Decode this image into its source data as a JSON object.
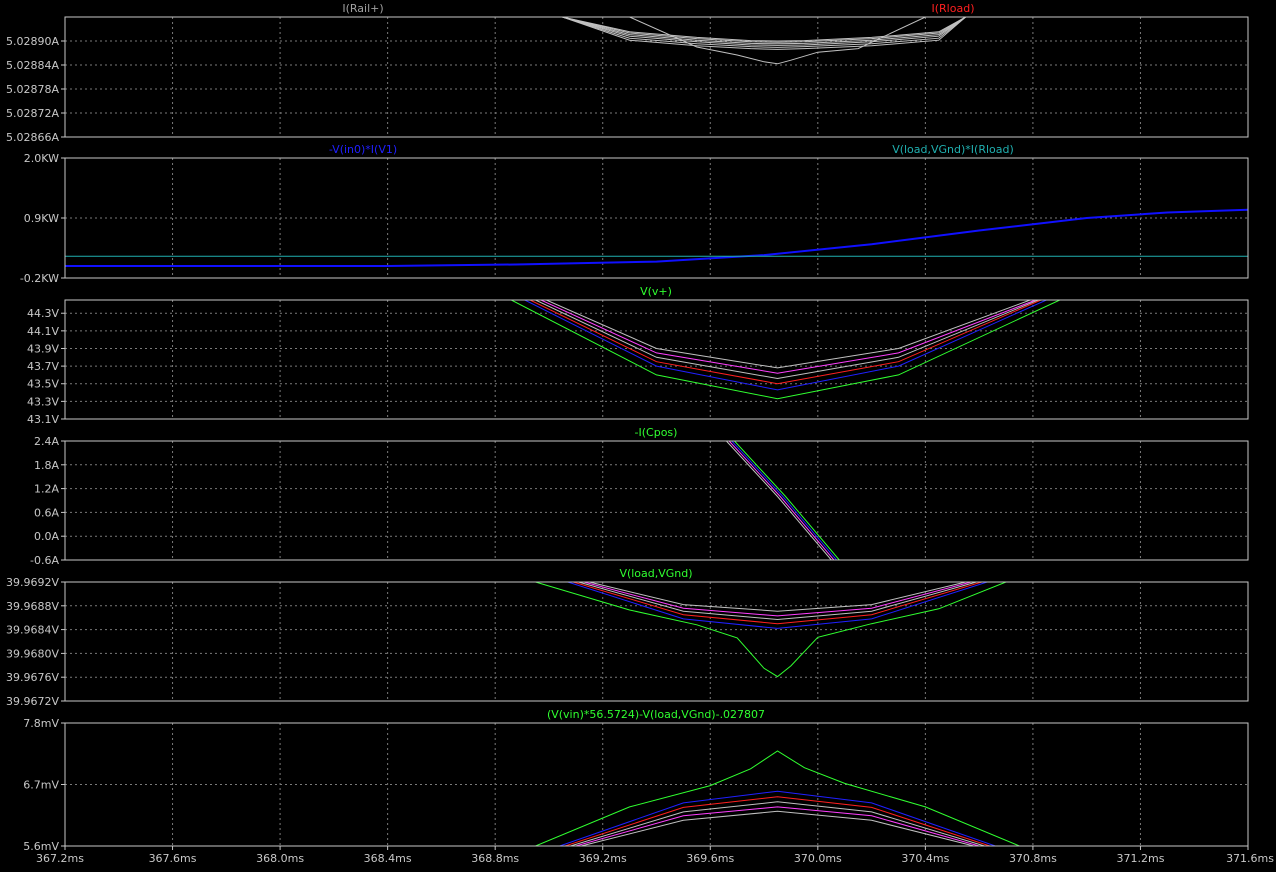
{
  "app": "LTspice waveform viewer",
  "chart_data": [
    {
      "type": "line",
      "pane": "rail-current",
      "trace_labels": [
        {
          "text": "I(Rail+)",
          "color": "#a0a0a0"
        },
        {
          "text": "I(Rload)",
          "color": "#ff2020"
        }
      ],
      "yunit": "A",
      "ylim": [
        5.02866,
        5.02896
      ],
      "yticks": [
        "5.02890A",
        "5.02884A",
        "5.02878A",
        "5.02872A",
        "5.02866A"
      ],
      "ytick_values": [
        5.0289,
        5.02884,
        5.02878,
        5.02872,
        5.02866
      ],
      "grid": true,
      "series": [
        {
          "color": "#c0c0c0",
          "x": [
            369.05,
            369.3,
            369.55,
            369.75,
            369.85,
            369.95,
            370.2,
            370.45,
            370.55
          ],
          "y": [
            5.02896,
            5.028923,
            5.028909,
            5.028901,
            5.0289,
            5.028901,
            5.028909,
            5.028923,
            5.02896
          ]
        },
        {
          "color": "#c0c0c0",
          "x": [
            369.05,
            369.3,
            369.55,
            369.75,
            369.85,
            369.95,
            370.2,
            370.45,
            370.55
          ],
          "y": [
            5.02896,
            5.02892,
            5.028906,
            5.028898,
            5.028897,
            5.028898,
            5.028906,
            5.02892,
            5.02896
          ]
        },
        {
          "color": "#c0c0c0",
          "x": [
            369.05,
            369.3,
            369.55,
            369.75,
            369.85,
            369.95,
            370.2,
            370.45,
            370.55
          ],
          "y": [
            5.02896,
            5.028916,
            5.028902,
            5.028894,
            5.028893,
            5.028894,
            5.028902,
            5.028916,
            5.02896
          ]
        },
        {
          "color": "#c0c0c0",
          "x": [
            369.05,
            369.3,
            369.55,
            369.75,
            369.85,
            369.95,
            370.2,
            370.45,
            370.55
          ],
          "y": [
            5.02896,
            5.028912,
            5.028898,
            5.02889,
            5.028889,
            5.02889,
            5.028898,
            5.028912,
            5.02896
          ]
        },
        {
          "color": "#c0c0c0",
          "x": [
            369.05,
            369.3,
            369.55,
            369.75,
            369.85,
            369.95,
            370.2,
            370.45,
            370.55
          ],
          "y": [
            5.02896,
            5.028907,
            5.028893,
            5.028886,
            5.028884,
            5.028886,
            5.028893,
            5.028907,
            5.02896
          ]
        },
        {
          "color": "#c0c0c0",
          "x": [
            369.05,
            369.3,
            369.55,
            369.75,
            369.85,
            369.95,
            370.2,
            370.45,
            370.55
          ],
          "y": [
            5.02896,
            5.028902,
            5.028888,
            5.028881,
            5.028879,
            5.028881,
            5.028888,
            5.028902,
            5.02896
          ]
        },
        {
          "color": "#c0c0c0",
          "x": [
            369.3,
            369.55,
            369.7,
            369.8,
            369.85,
            369.9,
            370.0,
            370.15,
            370.4
          ],
          "y": [
            5.02896,
            5.028885,
            5.028865,
            5.028848,
            5.028843,
            5.028852,
            5.028872,
            5.028881,
            5.02896
          ]
        }
      ]
    },
    {
      "type": "line",
      "pane": "power",
      "trace_labels": [
        {
          "text": "-V(in0)*I(V1)",
          "color": "#2020ff"
        },
        {
          "text": "V(load,VGnd)*I(Rload)",
          "color": "#20b0b0"
        }
      ],
      "yunit": "KW",
      "ylim": [
        -0.2,
        2.0
      ],
      "yticks": [
        "2.0KW",
        "0.9KW",
        "-0.2KW"
      ],
      "ytick_values": [
        2.0,
        0.9,
        -0.2
      ],
      "grid": true,
      "series": [
        {
          "color": "#1010ff",
          "x": [
            367.2,
            368.4,
            368.9,
            369.4,
            369.8,
            370.2,
            370.6,
            371.0,
            371.3,
            371.6
          ],
          "y": [
            0.02,
            0.02,
            0.05,
            0.1,
            0.22,
            0.42,
            0.67,
            0.9,
            1.0,
            1.05
          ]
        },
        {
          "color": "#20b0b0",
          "x": [
            367.2,
            371.6
          ],
          "y": [
            0.2,
            0.2
          ]
        }
      ]
    },
    {
      "type": "line",
      "pane": "rail-voltage",
      "trace_labels": [
        {
          "text": "V(v+)",
          "color": "#30ff30"
        }
      ],
      "yunit": "V",
      "ylim": [
        43.1,
        44.45
      ],
      "yticks": [
        "44.3V",
        "44.1V",
        "43.9V",
        "43.7V",
        "43.5V",
        "43.3V",
        "43.1V"
      ],
      "ytick_values": [
        44.3,
        44.1,
        43.9,
        43.7,
        43.5,
        43.3,
        43.1
      ],
      "grid": true,
      "series": [
        {
          "color": "#c0c0c0",
          "x": [
            368.99,
            369.4,
            369.85,
            370.3,
            370.79
          ],
          "y": [
            44.45,
            43.9,
            43.68,
            43.9,
            44.45
          ]
        },
        {
          "color": "#ff40ff",
          "x": [
            368.97,
            369.4,
            369.85,
            370.3,
            370.81
          ],
          "y": [
            44.45,
            43.85,
            43.62,
            43.85,
            44.45
          ]
        },
        {
          "color": "#c0c0c0",
          "x": [
            368.95,
            369.4,
            369.85,
            370.3,
            370.82
          ],
          "y": [
            44.45,
            43.8,
            43.56,
            43.8,
            44.45
          ]
        },
        {
          "color": "#ff2020",
          "x": [
            368.93,
            369.4,
            369.85,
            370.3,
            370.83
          ],
          "y": [
            44.45,
            43.75,
            43.5,
            43.75,
            44.45
          ]
        },
        {
          "color": "#2020ff",
          "x": [
            368.91,
            369.4,
            369.85,
            370.3,
            370.85
          ],
          "y": [
            44.45,
            43.7,
            43.43,
            43.7,
            44.45
          ]
        },
        {
          "color": "#30ff30",
          "x": [
            368.86,
            369.4,
            369.85,
            370.3,
            370.9
          ],
          "y": [
            44.45,
            43.6,
            43.33,
            43.6,
            44.45
          ]
        }
      ]
    },
    {
      "type": "line",
      "pane": "cap-current",
      "trace_labels": [
        {
          "text": "-I(Cpos)",
          "color": "#30ff30"
        }
      ],
      "yunit": "A",
      "ylim": [
        -0.6,
        2.4
      ],
      "yticks": [
        "2.4A",
        "1.8A",
        "1.2A",
        "0.6A",
        "0.0A",
        "-0.6A"
      ],
      "ytick_values": [
        2.4,
        1.8,
        1.2,
        0.6,
        0.0,
        -0.6
      ],
      "grid": true,
      "series": [
        {
          "color": "#c0c0c0",
          "x": [
            369.66,
            369.85,
            370.05
          ],
          "y": [
            2.4,
            1.0,
            -0.6
          ]
        },
        {
          "color": "#ff40ff",
          "x": [
            369.67,
            369.86,
            370.06
          ],
          "y": [
            2.4,
            1.0,
            -0.6
          ]
        },
        {
          "color": "#2020ff",
          "x": [
            369.68,
            369.87,
            370.07
          ],
          "y": [
            2.4,
            1.0,
            -0.6
          ]
        },
        {
          "color": "#30ff30",
          "x": [
            369.69,
            369.88,
            370.08
          ],
          "y": [
            2.4,
            1.0,
            -0.6
          ]
        }
      ]
    },
    {
      "type": "line",
      "pane": "load-voltage",
      "trace_labels": [
        {
          "text": "V(load,VGnd)",
          "color": "#30ff30"
        }
      ],
      "yunit": "V",
      "ylim": [
        39.9672,
        39.9692
      ],
      "yticks": [
        "39.9692V",
        "39.9688V",
        "39.9684V",
        "39.9680V",
        "39.9676V",
        "39.9672V"
      ],
      "ytick_values": [
        39.9692,
        39.9688,
        39.9684,
        39.968,
        39.9676,
        39.9672
      ],
      "grid": true,
      "series": [
        {
          "color": "#c0c0c0",
          "x": [
            369.15,
            369.5,
            369.85,
            370.2,
            370.55
          ],
          "y": [
            39.9692,
            39.96882,
            39.96871,
            39.96882,
            39.9692
          ]
        },
        {
          "color": "#ff40ff",
          "x": [
            369.13,
            369.5,
            369.85,
            370.2,
            370.57
          ],
          "y": [
            39.9692,
            39.96876,
            39.96863,
            39.96876,
            39.9692
          ]
        },
        {
          "color": "#c0c0c0",
          "x": [
            369.11,
            369.5,
            369.85,
            370.2,
            370.59
          ],
          "y": [
            39.9692,
            39.96871,
            39.96857,
            39.96871,
            39.9692
          ]
        },
        {
          "color": "#ff2020",
          "x": [
            369.09,
            369.5,
            369.85,
            370.2,
            370.61
          ],
          "y": [
            39.9692,
            39.96865,
            39.9685,
            39.96865,
            39.9692
          ]
        },
        {
          "color": "#2020ff",
          "x": [
            369.07,
            369.5,
            369.85,
            370.2,
            370.63
          ],
          "y": [
            39.9692,
            39.96858,
            39.96842,
            39.96858,
            39.9692
          ]
        },
        {
          "color": "#30ff30",
          "x": [
            368.95,
            369.3,
            369.55,
            369.7,
            369.8,
            369.85,
            369.9,
            370.0,
            370.2,
            370.45,
            370.7
          ],
          "y": [
            39.9692,
            39.96873,
            39.96848,
            39.96826,
            39.96775,
            39.96761,
            39.96779,
            39.96827,
            39.9685,
            39.96875,
            39.9692
          ]
        }
      ]
    },
    {
      "type": "line",
      "pane": "error-voltage",
      "trace_labels": [
        {
          "text": "(V(vin)*56.5724)-V(load,VGnd)-.027807",
          "color": "#30ff30"
        }
      ],
      "yunit": "mV",
      "ylim": [
        5.6,
        7.8
      ],
      "yticks": [
        "7.8mV",
        "6.7mV",
        "5.6mV"
      ],
      "ytick_values": [
        7.8,
        6.7,
        5.6
      ],
      "xlim": [
        367.2,
        371.6
      ],
      "xticks": [
        "367.2ms",
        "367.6ms",
        "368.0ms",
        "368.4ms",
        "368.8ms",
        "369.2ms",
        "369.6ms",
        "370.0ms",
        "370.4ms",
        "370.8ms",
        "371.2ms",
        "371.6ms"
      ],
      "xtick_values": [
        367.2,
        367.6,
        368.0,
        368.4,
        368.8,
        369.2,
        369.6,
        370.0,
        370.4,
        370.8,
        371.2,
        371.6
      ],
      "grid": true,
      "series": [
        {
          "color": "#c0c0c0",
          "x": [
            369.12,
            369.5,
            369.85,
            370.2,
            370.58
          ],
          "y": [
            5.6,
            6.06,
            6.22,
            6.06,
            5.6
          ]
        },
        {
          "color": "#ff40ff",
          "x": [
            369.1,
            369.5,
            369.85,
            370.2,
            370.6
          ],
          "y": [
            5.6,
            6.14,
            6.3,
            6.14,
            5.6
          ]
        },
        {
          "color": "#c0c0c0",
          "x": [
            369.08,
            369.5,
            369.85,
            370.2,
            370.62
          ],
          "y": [
            5.6,
            6.21,
            6.39,
            6.21,
            5.6
          ]
        },
        {
          "color": "#ff2020",
          "x": [
            369.06,
            369.5,
            369.85,
            370.2,
            370.64
          ],
          "y": [
            5.6,
            6.29,
            6.48,
            6.29,
            5.6
          ]
        },
        {
          "color": "#2020ff",
          "x": [
            369.04,
            369.5,
            369.85,
            370.2,
            370.66
          ],
          "y": [
            5.6,
            6.37,
            6.58,
            6.37,
            5.6
          ]
        },
        {
          "color": "#30ff30",
          "x": [
            368.95,
            369.3,
            369.6,
            369.75,
            369.85,
            369.95,
            370.1,
            370.4,
            370.75
          ],
          "y": [
            5.6,
            6.3,
            6.68,
            6.98,
            7.3,
            7.0,
            6.72,
            6.3,
            5.6
          ]
        }
      ]
    }
  ]
}
